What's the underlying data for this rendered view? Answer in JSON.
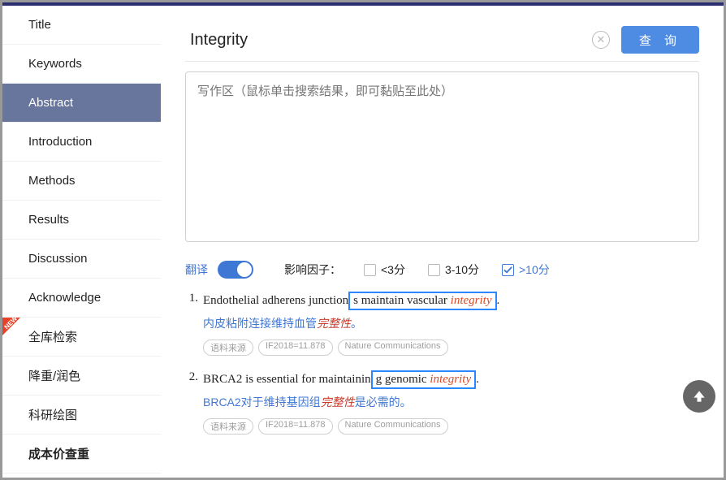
{
  "sidebar": {
    "items": [
      {
        "label": "Title"
      },
      {
        "label": "Keywords"
      },
      {
        "label": "Abstract"
      },
      {
        "label": "Introduction"
      },
      {
        "label": "Methods"
      },
      {
        "label": "Results"
      },
      {
        "label": "Discussion"
      },
      {
        "label": "Acknowledge"
      },
      {
        "label": "全库检索"
      },
      {
        "label": "降重/润色"
      },
      {
        "label": "科研绘图"
      },
      {
        "label": "成本价查重"
      }
    ],
    "activeIndex": 2
  },
  "search": {
    "value": "Integrity",
    "query_btn": "查 询"
  },
  "writeArea": {
    "placeholder": "写作区（鼠标单击搜索结果，即可黏贴至此处）"
  },
  "filters": {
    "translate_label": "翻译",
    "impact_label": "影响因子：",
    "options": [
      {
        "label": "<3分",
        "checked": false
      },
      {
        "label": "3-10分",
        "checked": false
      },
      {
        "label": ">10分",
        "checked": true
      }
    ]
  },
  "results": [
    {
      "num": "1.",
      "sentence_pre": "Endothelial adherens junction",
      "sentence_hl_pre": "s maintain vascular ",
      "sentence_hl_em": "integrity",
      "sentence_post": ".",
      "trans_pre": "内皮粘附连接维持血管",
      "trans_red": "完整性",
      "trans_post": "。",
      "tags": [
        "语料来源",
        "IF2018=11.878",
        "Nature Communications"
      ]
    },
    {
      "num": "2.",
      "sentence_pre": "BRCA2 is essential for maintainin",
      "sentence_hl_pre": "g genomic ",
      "sentence_hl_em": "integrity",
      "sentence_post": ".",
      "trans_pre": "BRCA2对于维持基因组",
      "trans_red": "完整性",
      "trans_post": "是必需的。",
      "tags": [
        "语料来源",
        "IF2018=11.878",
        "Nature Communications"
      ]
    }
  ]
}
